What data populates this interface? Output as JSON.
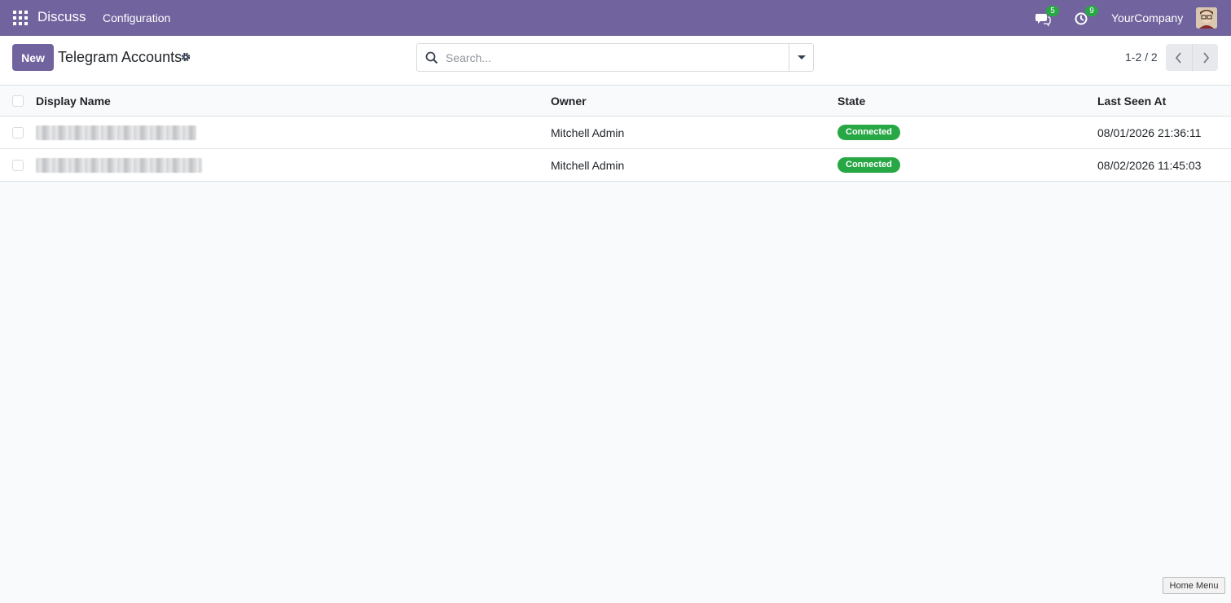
{
  "navbar": {
    "app_name": "Discuss",
    "menu": [
      "Configuration"
    ],
    "messages_count": "5",
    "activities_count": "9",
    "company": "YourCompany"
  },
  "control_panel": {
    "new_label": "New",
    "title": "Telegram Accounts",
    "search_placeholder": "Search...",
    "pager": "1-2 / 2"
  },
  "table": {
    "columns": [
      "Display Name",
      "Owner",
      "State",
      "Last Seen At"
    ],
    "rows": [
      {
        "owner": "Mitchell Admin",
        "state": "Connected",
        "last_seen": "08/01/2026 21:36:11"
      },
      {
        "owner": "Mitchell Admin",
        "state": "Connected",
        "last_seen": "08/02/2026 11:45:03"
      }
    ]
  },
  "colors": {
    "brand": "#71639e",
    "success": "#28a745"
  },
  "icons": [
    "apps-icon",
    "chat-icon",
    "activity-icon",
    "gear-icon",
    "search-icon",
    "caret-down-icon",
    "chevron-left-icon",
    "chevron-right-icon"
  ],
  "tooltip": "Home Menu"
}
